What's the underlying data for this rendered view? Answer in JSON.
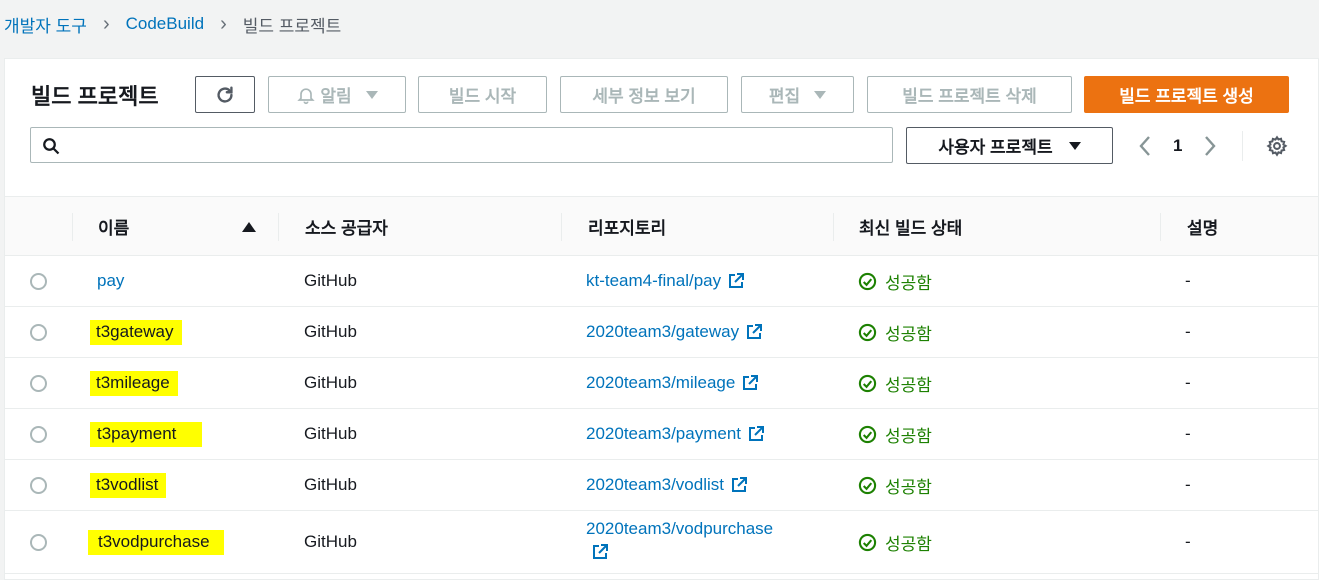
{
  "breadcrumb": [
    "개발자 도구",
    "CodeBuild",
    "빌드 프로젝트"
  ],
  "panel_title": "빌드 프로젝트",
  "toolbar": {
    "alarm_label": "알림",
    "start_build_label": "빌드 시작",
    "details_label": "세부 정보 보기",
    "edit_label": "편집",
    "delete_label": "빌드 프로젝트 삭제",
    "create_label": "빌드 프로젝트 생성"
  },
  "search": {
    "placeholder": "",
    "value": ""
  },
  "filter": {
    "selected": "사용자 프로젝트"
  },
  "pagination": {
    "current": "1"
  },
  "columns": {
    "name": "이름",
    "source": "소스 공급자",
    "repo": "리포지토리",
    "status": "최신 빌드 상태",
    "desc": "설명"
  },
  "rows": [
    {
      "name": "pay",
      "source": "GitHub",
      "repo": "kt-team4-final/pay",
      "status": "성공함",
      "desc": "-",
      "highlighted": false
    },
    {
      "name": "t3gateway",
      "source": "GitHub",
      "repo": "2020team3/gateway",
      "status": "성공함",
      "desc": "-",
      "highlighted": true
    },
    {
      "name": "t3mileage",
      "source": "GitHub",
      "repo": "2020team3/mileage",
      "status": "성공함",
      "desc": "-",
      "highlighted": true
    },
    {
      "name": "t3payment",
      "source": "GitHub",
      "repo": "2020team3/payment",
      "status": "성공함",
      "desc": "-",
      "highlighted": true
    },
    {
      "name": "t3vodlist",
      "source": "GitHub",
      "repo": "2020team3/vodlist",
      "status": "성공함",
      "desc": "-",
      "highlighted": true
    },
    {
      "name": "t3vodpurchase",
      "source": "GitHub",
      "repo": "2020team3/vodpurchase",
      "status": "성공함",
      "desc": "-",
      "highlighted": true
    }
  ],
  "colors": {
    "link": "#0073bb",
    "primary": "#ec7211",
    "success": "#1d8102",
    "highlight": "#ffff00"
  }
}
